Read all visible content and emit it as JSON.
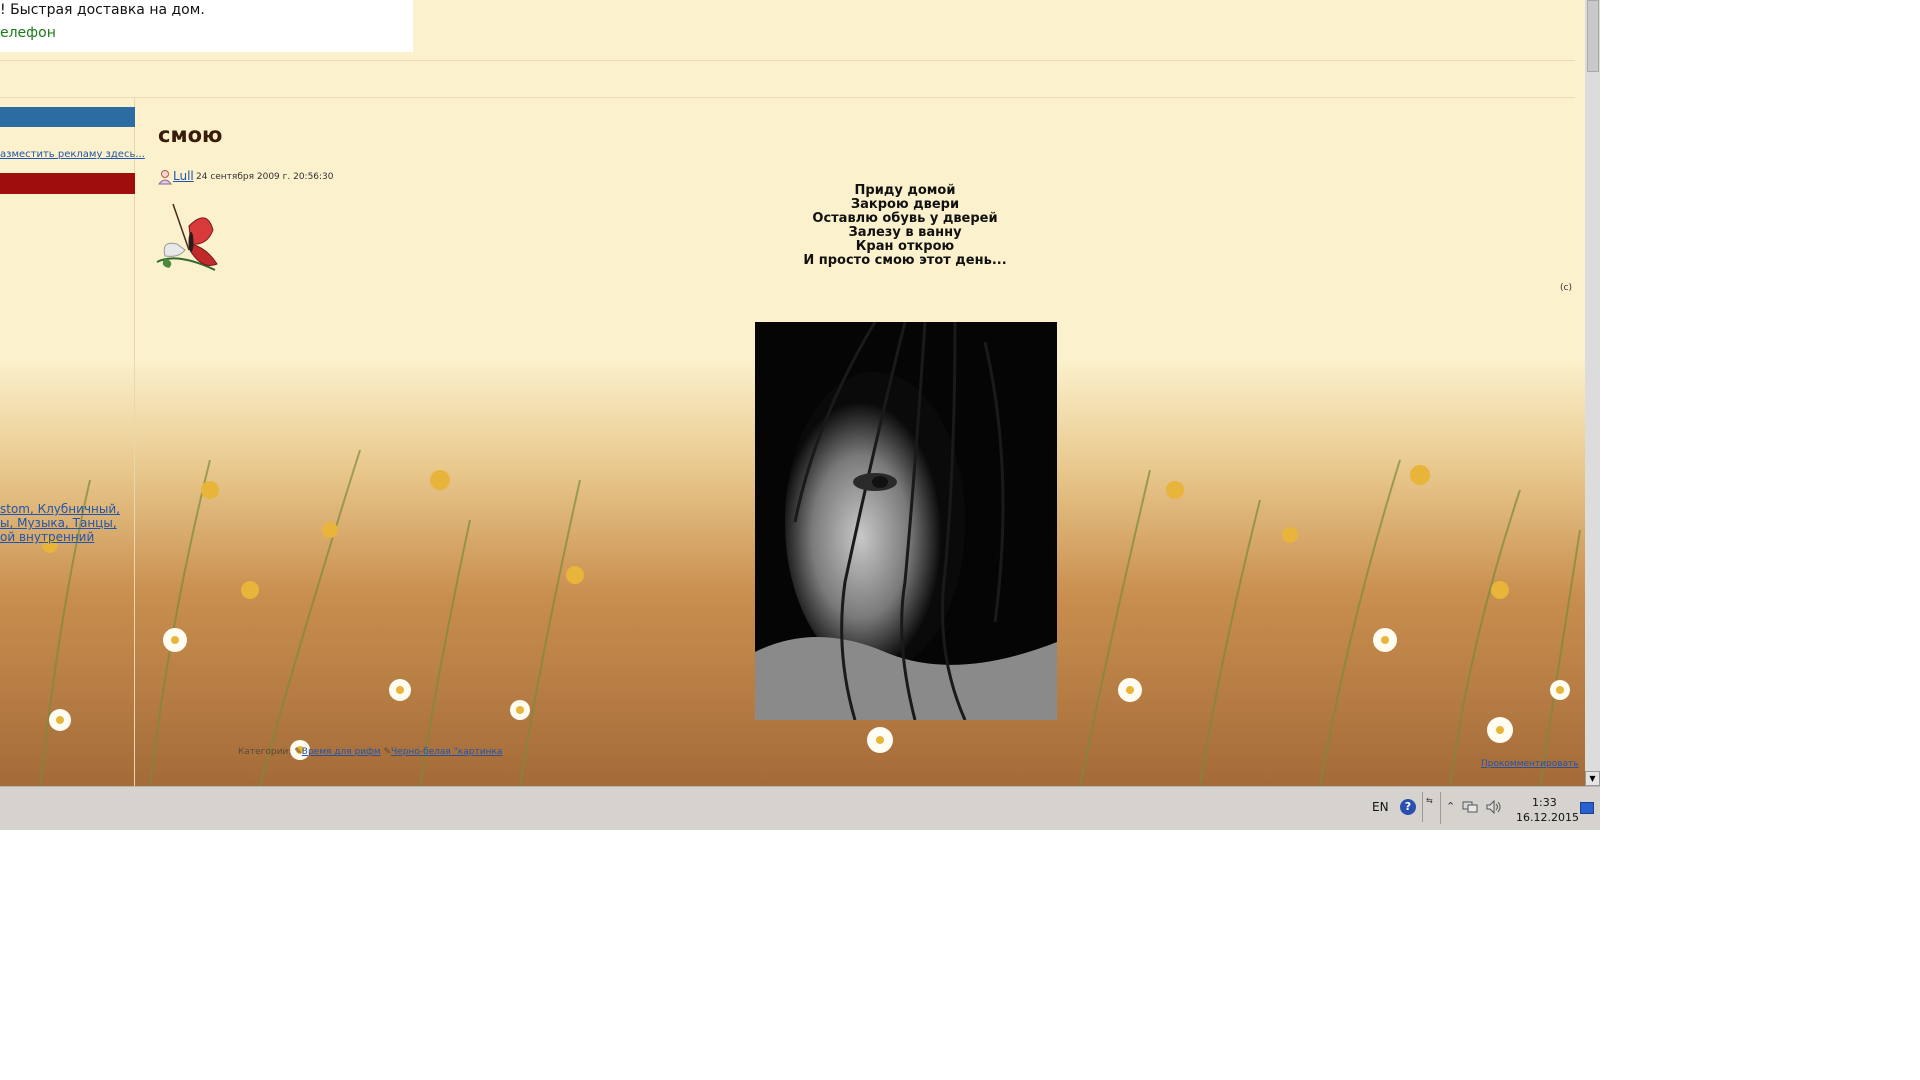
{
  "ad": {
    "line1": "! Быстрая доставка на дом.",
    "line2": "елефон"
  },
  "sidebar": {
    "ad_link": "азместить рекламу здесь...",
    "tags": [
      "stom, Клубничный,",
      "ы, Музыка, Танцы,",
      "ой внутренний"
    ]
  },
  "post": {
    "title": "смою",
    "author": "Lull",
    "date": "24 сентября 2009 г. 20:56:30",
    "poem": [
      "Приду домой",
      "Закрою двери",
      "Оставлю обувь у дверей",
      "Залезу в ванну",
      "Кран открою",
      "И просто смою этот день..."
    ],
    "copyright": "(с)",
    "categories_label": "Категории:",
    "categories": [
      "Время для рифм",
      "Черно-белая \"картинка"
    ],
    "comment_link": "Прокомментировать"
  },
  "taskbar": {
    "language": "EN",
    "help_glyph": "?",
    "arrows_glyph": "⇆",
    "tray_up_glyph": "⌃",
    "time": "1:33",
    "date": "16.12.2015"
  },
  "scrollbar": {
    "down_glyph": "▼"
  },
  "icons": {
    "author": "user-icon",
    "help": "help-icon",
    "network": "network-icon",
    "volume": "volume-icon",
    "desktop": "show-desktop-icon"
  },
  "colors": {
    "page_bg": "#fbf1cc",
    "sidebar_blue": "#2b6ca3",
    "sidebar_red": "#a00d0d",
    "link": "#2255aa",
    "title": "#3a1a0a",
    "taskbar": "#d6d3ce"
  }
}
